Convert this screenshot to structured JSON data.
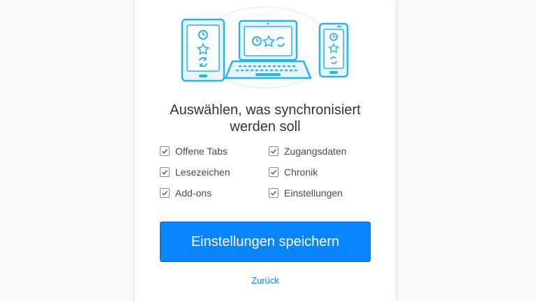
{
  "dialog": {
    "title_line1": "Auswählen, was synchronisiert",
    "title_line2": "werden soll"
  },
  "preferences": [
    {
      "label": "Offene Tabs",
      "checked": true
    },
    {
      "label": "Zugangsdaten",
      "checked": true
    },
    {
      "label": "Lesezeichen",
      "checked": true
    },
    {
      "label": "Chronik",
      "checked": true
    },
    {
      "label": "Add-ons",
      "checked": true
    },
    {
      "label": "Einstellungen",
      "checked": true
    }
  ],
  "actions": {
    "save_label": "Einstellungen speichern",
    "back_label": "Zurück"
  },
  "colors": {
    "accent": "#0a84ff",
    "illustration": "#2bb3e8",
    "checkbox_border": "#8a8a8f"
  },
  "illustration": {
    "devices": [
      "tablet-icon",
      "laptop-icon",
      "phone-icon"
    ],
    "glyphs": [
      "clock-icon",
      "star-icon",
      "sync-icon"
    ]
  }
}
